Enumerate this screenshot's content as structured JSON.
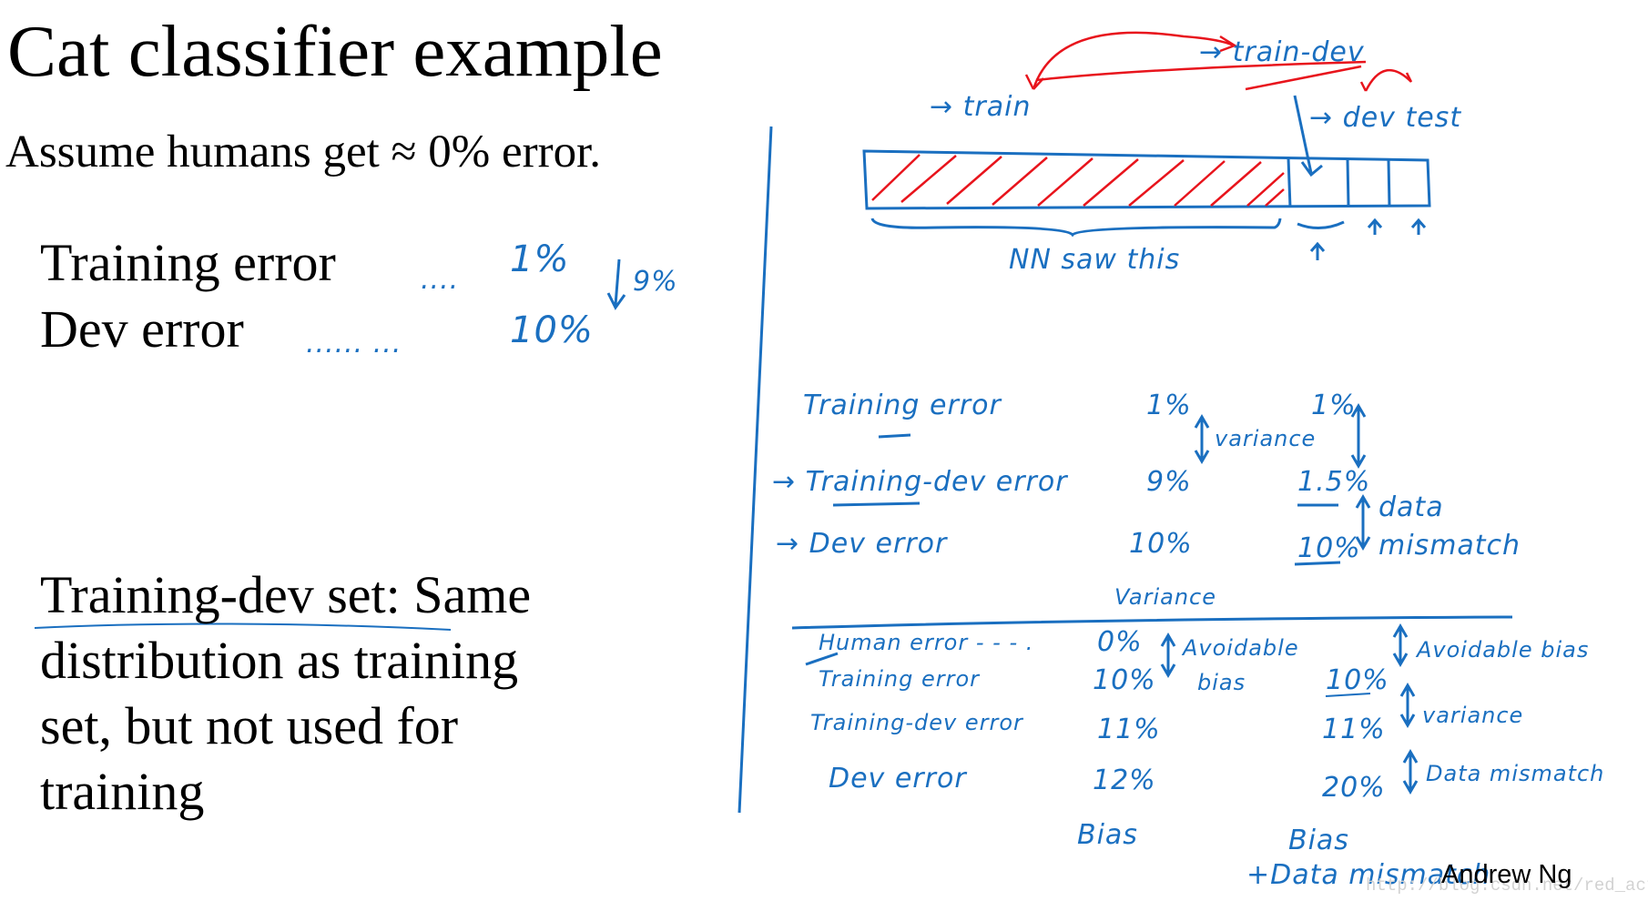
{
  "slide": {
    "title": "Cat classifier example",
    "assumption": "Assume humans get ≈ 0% error.",
    "left_rows": [
      {
        "label": "Training error",
        "dots": "....",
        "value": "1%"
      },
      {
        "label": "Dev error",
        "dots": "...... ...",
        "value": "10%"
      }
    ],
    "gap_note": "9%",
    "definition_lines": [
      "Training-dev set: Same",
      "distribution as training",
      "set, but not used for",
      "training"
    ],
    "author": "Andrew Ng",
    "watermark": "http://blog.csdn.net/red_actor"
  },
  "diagram": {
    "train_label": "→ train",
    "train_dev_label": "→ train-dev",
    "dev_test_label": "→ dev  test",
    "nn_saw_label": "NN  saw  this",
    "colors": {
      "ink": "#1a6fc0",
      "red": "#e8141c"
    }
  },
  "table1": {
    "rows": [
      {
        "label": "Training error",
        "a": "1%",
        "b": "1%"
      },
      {
        "label": "→ Training-dev error",
        "a": "9%",
        "b": "1.5%"
      },
      {
        "label": "→ Dev error",
        "a": "10%",
        "b": "10%"
      }
    ],
    "variance_note": "variance",
    "data_mismatch_note": [
      "data",
      "mismatch"
    ],
    "col_a_diagnosis": "Variance"
  },
  "table2": {
    "rows": [
      {
        "label": "Human error  - - - .",
        "a": "0%",
        "b": ""
      },
      {
        "label": "Training error",
        "a": "10%",
        "b": "10%"
      },
      {
        "label": "Training-dev error",
        "a": "11%",
        "b": "11%"
      },
      {
        "label": "Dev error",
        "a": "12%",
        "b": "20%"
      }
    ],
    "a_note": [
      "Avoidable",
      "bias"
    ],
    "b_notes": [
      "Avoidable bias",
      "variance",
      "Data mismatch"
    ],
    "a_diagnosis": "Bias",
    "b_diagnosis": [
      "Bias",
      "+Data mismatch"
    ]
  }
}
